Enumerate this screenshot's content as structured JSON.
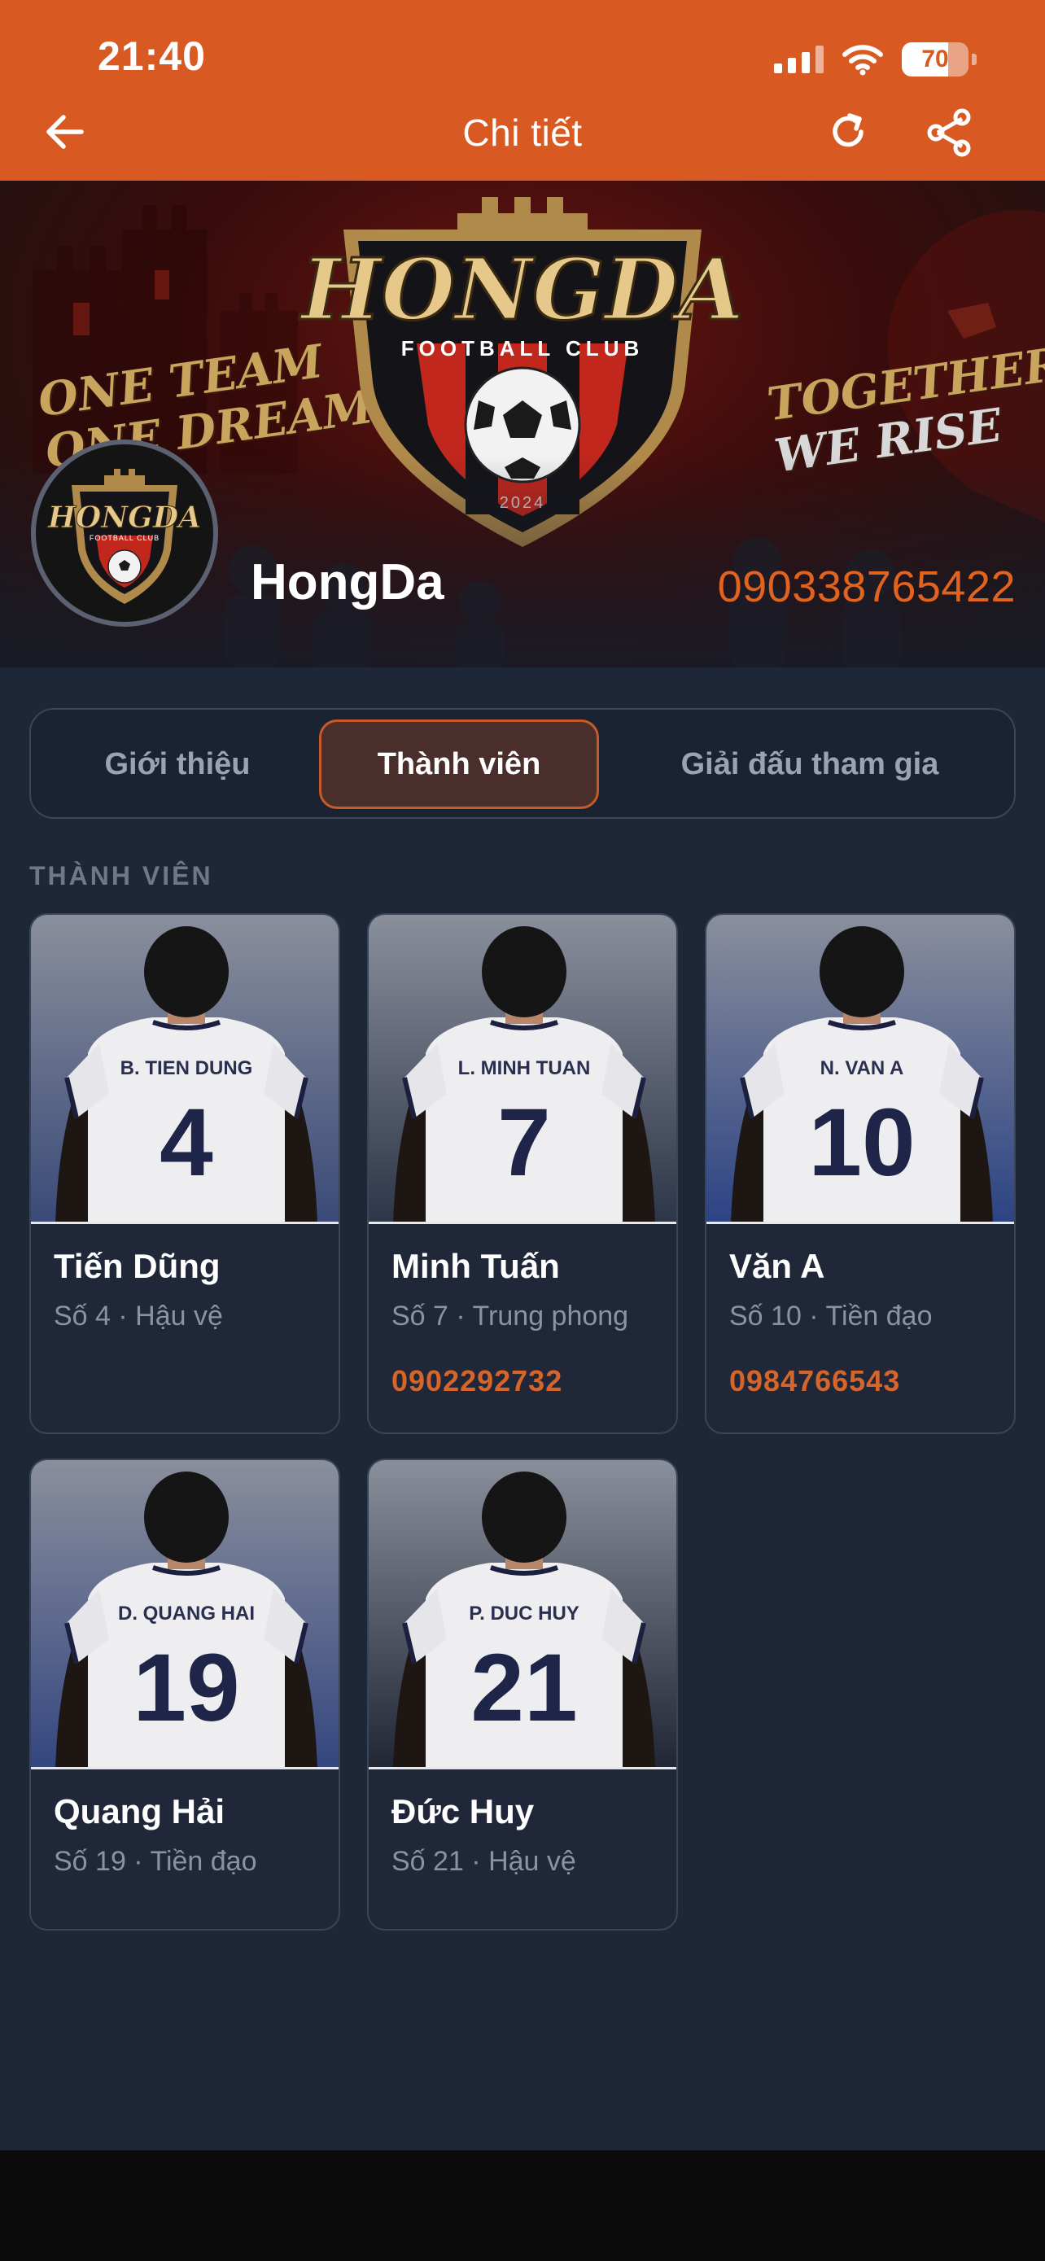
{
  "status": {
    "time": "21:40",
    "battery": "70",
    "battery_fraction": 0.7
  },
  "nav": {
    "title": "Chi tiết"
  },
  "colors": {
    "accent": "#d85a22",
    "background": "#1e2738",
    "phone": "#e2621f"
  },
  "banner": {
    "slogan_left": [
      "ONE TEAM",
      "ONE DREAM"
    ],
    "slogan_right": [
      "TOGETHER",
      "WE RISE"
    ],
    "crest_title": "HONGDA",
    "crest_subtitle": "FOOTBALL CLUB",
    "crest_year": "2024"
  },
  "team": {
    "name": "HongDa",
    "phone": "090338765422",
    "avatar_title": "HONGDA",
    "avatar_subtitle": "FOOTBALL CLUB"
  },
  "tabs": [
    {
      "label": "Giới thiệu",
      "active": false
    },
    {
      "label": "Thành viên",
      "active": true
    },
    {
      "label": "Giải đấu tham gia",
      "active": false
    }
  ],
  "section_label": "THÀNH VIÊN",
  "members": [
    {
      "name": "Tiến Dũng",
      "info": "Số 4 · Hậu vệ",
      "phone": "",
      "shirt_name": "B. TIEN DUNG",
      "shirt_number": "4"
    },
    {
      "name": "Minh Tuấn",
      "info": "Số 7 · Trung phong",
      "phone": "0902292732",
      "shirt_name": "L. MINH TUAN",
      "shirt_number": "7"
    },
    {
      "name": "Văn A",
      "info": "Số 10 · Tiền đạo",
      "phone": "0984766543",
      "shirt_name": "N. VAN A",
      "shirt_number": "10"
    },
    {
      "name": "Quang Hải",
      "info": "Số 19 · Tiền đạo",
      "phone": "",
      "shirt_name": "D. QUANG HAI",
      "shirt_number": "19"
    },
    {
      "name": "Đức Huy",
      "info": "Số 21 · Hậu vệ",
      "phone": "",
      "shirt_name": "P. DUC HUY",
      "shirt_number": "21"
    }
  ]
}
